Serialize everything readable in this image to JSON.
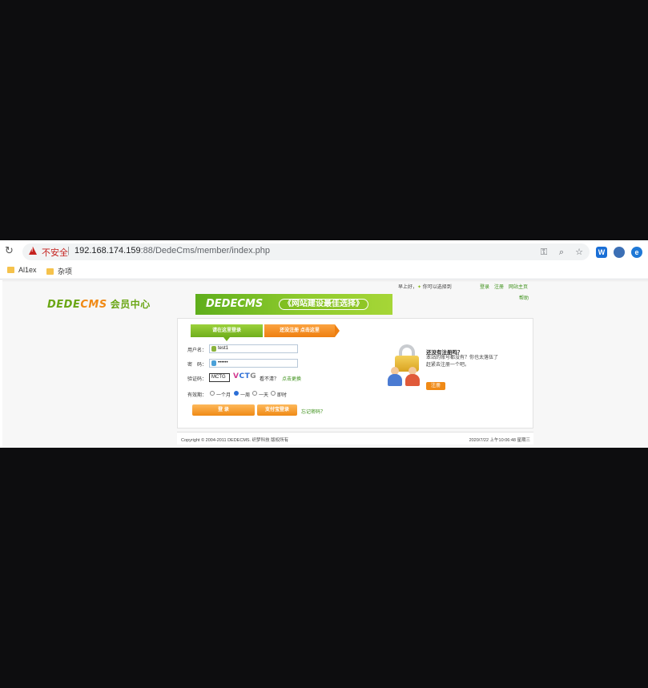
{
  "browser": {
    "security_label": "不安全",
    "separator": "|",
    "url_host": "192.168.174.159",
    "url_rest": ":88/DedeCms/member/index.php",
    "icons": [
      "reload-icon",
      "key-icon",
      "zoom-icon",
      "star-icon",
      "w-extension-icon",
      "shield-extension-icon",
      "ie-extension-icon"
    ],
    "ext_w": "W",
    "ext_e": "e",
    "bookmarks": [
      {
        "label": "Al1ex"
      },
      {
        "label": "杂项"
      }
    ]
  },
  "header": {
    "greeting": "早上好，",
    "greeting_sub": "你可以选择到",
    "links": {
      "login": "登录",
      "register": "注册",
      "site_home": "网站主页"
    },
    "help": "帮助",
    "logo_main": "DEDE",
    "logo_accent": "CMS",
    "logo_sub": "会员中心",
    "banner_brand": "DEDECMS",
    "banner_slogan": "《网站建设最佳选择》"
  },
  "login": {
    "tab_login": "请在这里登录",
    "tab_register": "还没注册 点击这里",
    "username_label": "用户名：",
    "username_value": "test1",
    "password_label": "密　码：",
    "password_value": "••••••",
    "captcha_label": "验证码：",
    "captcha_value": "MCTG",
    "captcha_image": [
      "V",
      "C",
      "T",
      "G"
    ],
    "captcha_hint": "看不清？",
    "captcha_refresh": "点击更换",
    "validity_label": "有效期：",
    "validity_options": [
      "一个月",
      "一周",
      "一天",
      "即时"
    ],
    "validity_selected": "一周",
    "login_button": "登 录",
    "alipay_button": "支付宝登录",
    "forgot_link": "忘记密码？"
  },
  "register_panel": {
    "title": "还没有注册吗？",
    "text": "本站的账号都没有？你也太落伍了",
    "text2": "赶紧去注册一个吧。",
    "button": "注册"
  },
  "footer": {
    "copyright": "Copyright © 2004-2011 DEDECMS. 织梦科技 版权所有",
    "datetime": "2020/7/22 上午10:06:48 星期三"
  },
  "colors": {
    "brand_green": "#6aa615",
    "brand_orange": "#f08a16",
    "warning_red": "#c5221f"
  }
}
